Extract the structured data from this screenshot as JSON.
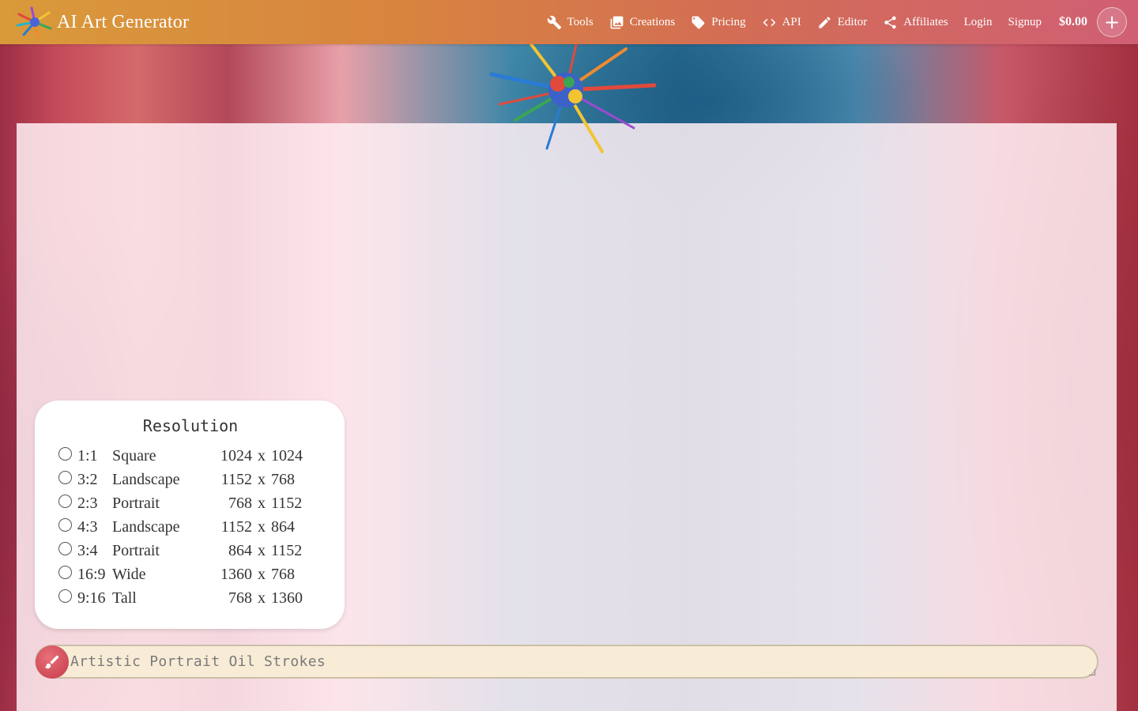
{
  "app": {
    "title": "AI Art Generator"
  },
  "nav": {
    "items": [
      {
        "label": "Tools",
        "icon": "wrench-icon"
      },
      {
        "label": "Creations",
        "icon": "image-icon"
      },
      {
        "label": "Pricing",
        "icon": "tag-icon"
      },
      {
        "label": "API",
        "icon": "code-icon"
      },
      {
        "label": "Editor",
        "icon": "pencil-icon"
      },
      {
        "label": "Affiliates",
        "icon": "share-icon"
      }
    ],
    "login": "Login",
    "signup": "Signup",
    "balance": "$0.00",
    "add_label": "+"
  },
  "resolution": {
    "title": "Resolution",
    "options": [
      {
        "ratio": "1:1",
        "name": "Square",
        "w": "1024",
        "x": "x",
        "h": "1024"
      },
      {
        "ratio": "3:2",
        "name": "Landscape",
        "w": "1152",
        "x": "x",
        "h": "768"
      },
      {
        "ratio": "2:3",
        "name": "Portrait",
        "w": "768",
        "x": "x",
        "h": "1152"
      },
      {
        "ratio": "4:3",
        "name": "Landscape",
        "w": "1152",
        "x": "x",
        "h": "864"
      },
      {
        "ratio": "3:4",
        "name": "Portrait",
        "w": "864",
        "x": "x",
        "h": "1152"
      },
      {
        "ratio": "16:9",
        "name": "Wide",
        "w": "1360",
        "x": "x",
        "h": "768"
      },
      {
        "ratio": "9:16",
        "name": "Tall",
        "w": "768",
        "x": "x",
        "h": "1360"
      }
    ]
  },
  "prompt": {
    "value": "Artistic Portrait Oil Strokes"
  },
  "colors": {
    "topbar_start": "#d99a3a",
    "topbar_end": "#d05f74",
    "brush_button": "#c33a48",
    "prompt_bg": "#f8ecd6"
  }
}
